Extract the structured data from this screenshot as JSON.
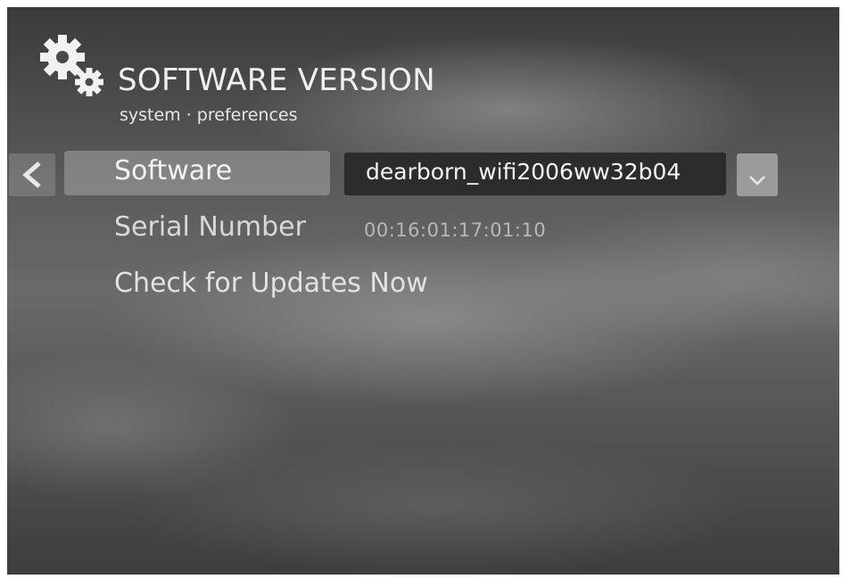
{
  "header": {
    "title": "SOFTWARE VERSION",
    "subtitle": "system · preferences",
    "icon": "gears-icon"
  },
  "settings": {
    "software": {
      "label": "Software",
      "value": "dearborn_wifi2006ww32b04"
    },
    "serial": {
      "label": "Serial Number",
      "value": "00:16:01:17:01:10"
    },
    "updates": {
      "label": "Check for Updates Now"
    }
  },
  "icons": {
    "back": "chevron-left-icon",
    "dropdown": "chevron-down-icon"
  },
  "colors": {
    "selected_row": "#a5a5a5",
    "value_box": "#2c2c2c",
    "text": "#f2f2f2",
    "muted_text": "#b8b8b8"
  }
}
